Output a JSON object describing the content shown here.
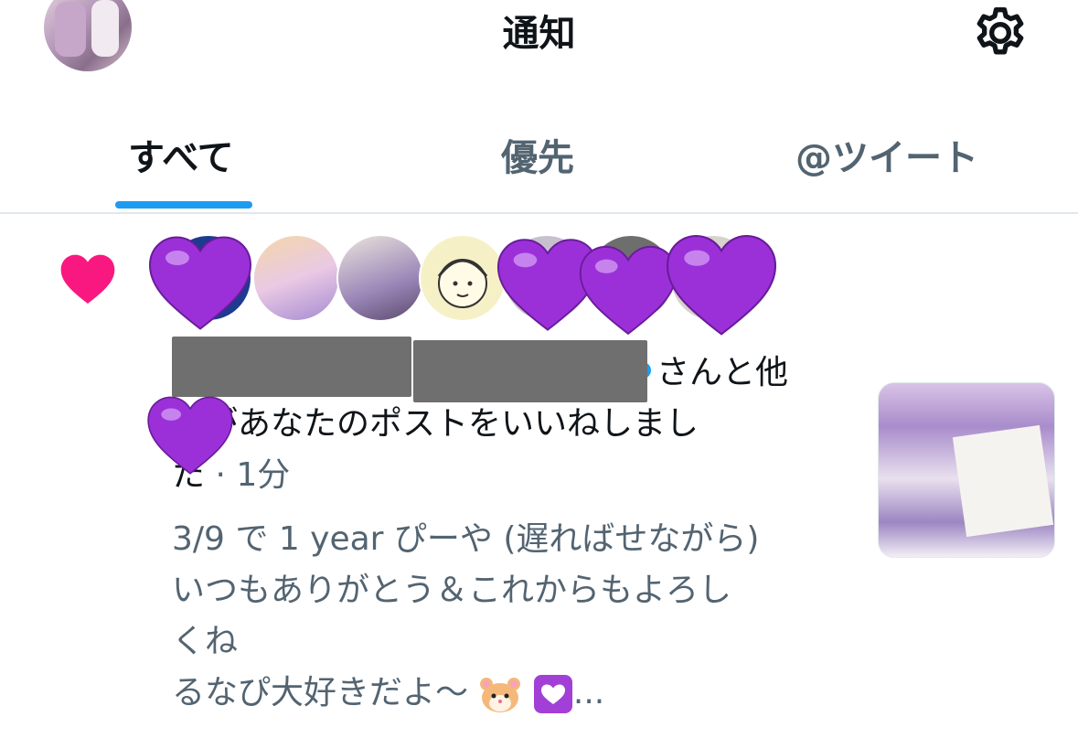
{
  "header": {
    "title": "通知"
  },
  "tabs": [
    {
      "label": "すべて",
      "active": true
    },
    {
      "label": "優先",
      "active": false
    },
    {
      "label": "@ツイート",
      "active": false
    }
  ],
  "notification": {
    "type_icon": "heart-icon",
    "line1_tail": "さんと他",
    "line2": "人があなたのポストをいいねしまし",
    "line3": "た",
    "separator": " · ",
    "time": "1分",
    "post_lines": [
      "3/9 で 1 year ぴーや (遅ればせながら)",
      "いつもありがとう＆これからもよろし",
      "くね",
      "るなぴ大好きだよ〜"
    ],
    "post_ellipsis": "..."
  },
  "colors": {
    "accent": "#1d9bf0",
    "like": "#f91880",
    "text_primary": "#0f1419",
    "text_secondary": "#536471",
    "redaction": "#6f6f6f",
    "sticker_heart": "#9b30d9"
  }
}
